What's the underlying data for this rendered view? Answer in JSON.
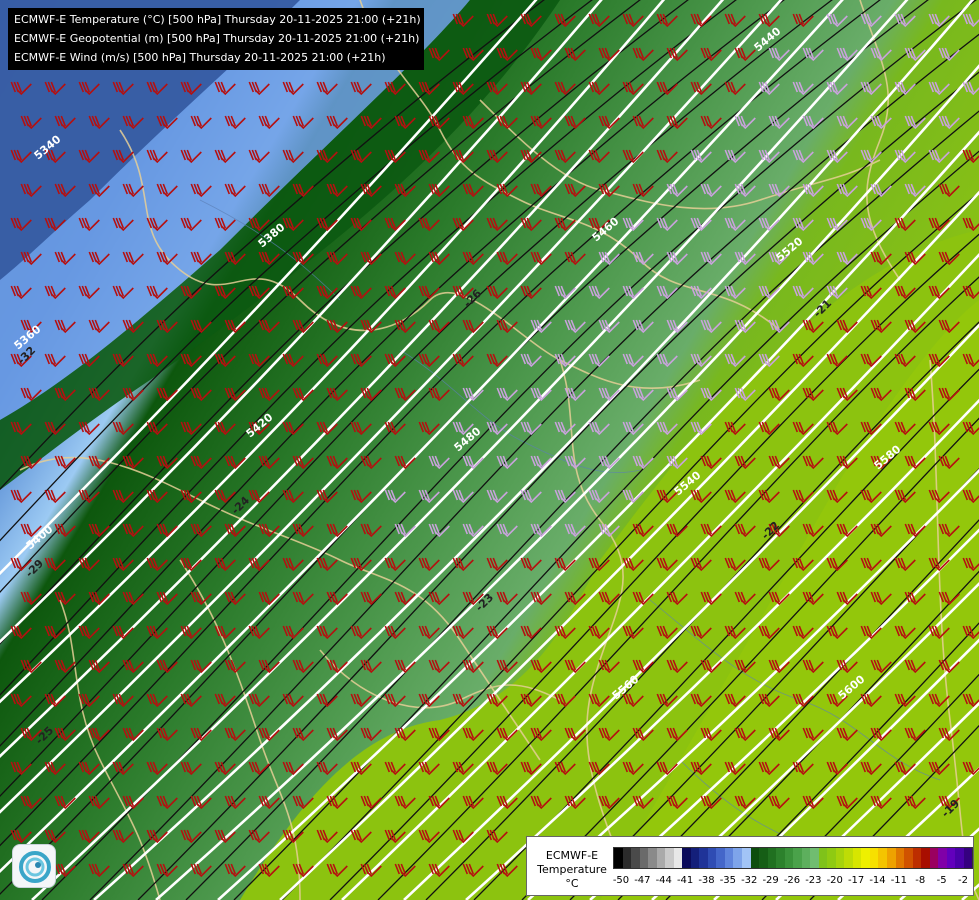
{
  "header": {
    "lines": [
      "ECMWF-E Temperature (°C) [500 hPa] Thursday 20-11-2025 21:00 (+21h)",
      "ECMWF-E Geopotential (m) [500 hPa] Thursday 20-11-2025 21:00 (+21h)",
      "ECMWF-E Wind (m/s) [500 hPa] Thursday 20-11-2025 21:00 (+21h)"
    ]
  },
  "geopotential_labels": [
    "5340",
    "5360",
    "5380",
    "5400",
    "5420",
    "5440",
    "5460",
    "5480",
    "5520",
    "5540",
    "5560",
    "5580",
    "5600"
  ],
  "temperature_labels": [
    "-32",
    "-29",
    "-26",
    "-25",
    "-24",
    "-23",
    "-22",
    "-21",
    "-19"
  ],
  "legend": {
    "title_lines": [
      "ECMWF-E",
      "Temperature",
      "°C"
    ],
    "ticks": [
      "-50",
      "-47",
      "-44",
      "-41",
      "-38",
      "-35",
      "-32",
      "-29",
      "-26",
      "-23",
      "-20",
      "-17",
      "-14",
      "-11",
      "-8",
      "-5",
      "-2"
    ],
    "colors": [
      "#000000",
      "#2b2b2b",
      "#4a4a4a",
      "#6a6a6a",
      "#8a8a8a",
      "#aaaaaa",
      "#cacaca",
      "#e8e8e8",
      "#0b0b5a",
      "#141f7a",
      "#1f3398",
      "#2f4cb3",
      "#4466c9",
      "#5f84dc",
      "#7ea4ea",
      "#a2c4f6",
      "#0d4d0d",
      "#165e16",
      "#207020",
      "#2c812c",
      "#3a923a",
      "#4aa24a",
      "#5daf5d",
      "#70bd70",
      "#7fc21a",
      "#8fca12",
      "#a6d30c",
      "#bedc06",
      "#d7e600",
      "#eef000",
      "#f7e000",
      "#f4c400",
      "#eea200",
      "#e07800",
      "#d05200",
      "#bd2e00",
      "#a80e00",
      "#9a0060",
      "#8000a8",
      "#6200bc",
      "#4a00a8",
      "#350080"
    ]
  }
}
